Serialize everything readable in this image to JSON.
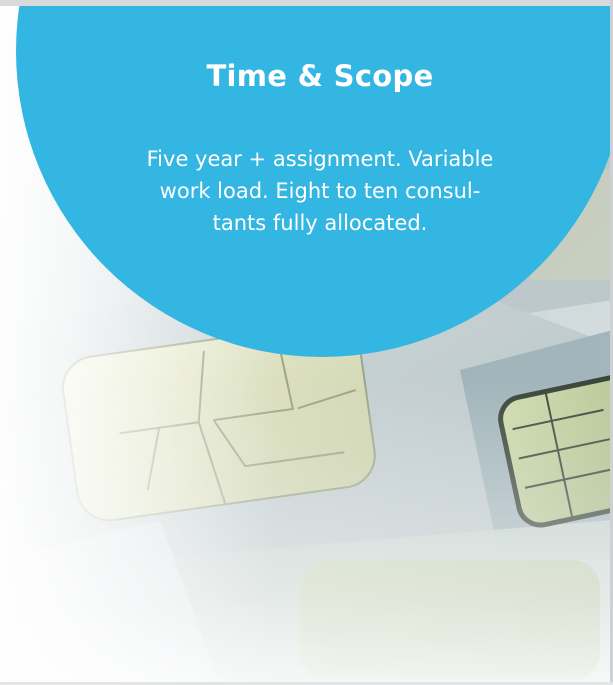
{
  "panel": {
    "title": "Time & Scope",
    "body_lines": [
      "Five year + assignment. Variable",
      "work load. Eight to ten consul-",
      "tants fully allocated."
    ]
  },
  "colors": {
    "circle": "#33b6e2",
    "text": "#ffffff"
  },
  "image": {
    "subject": "chip-card-photo"
  }
}
